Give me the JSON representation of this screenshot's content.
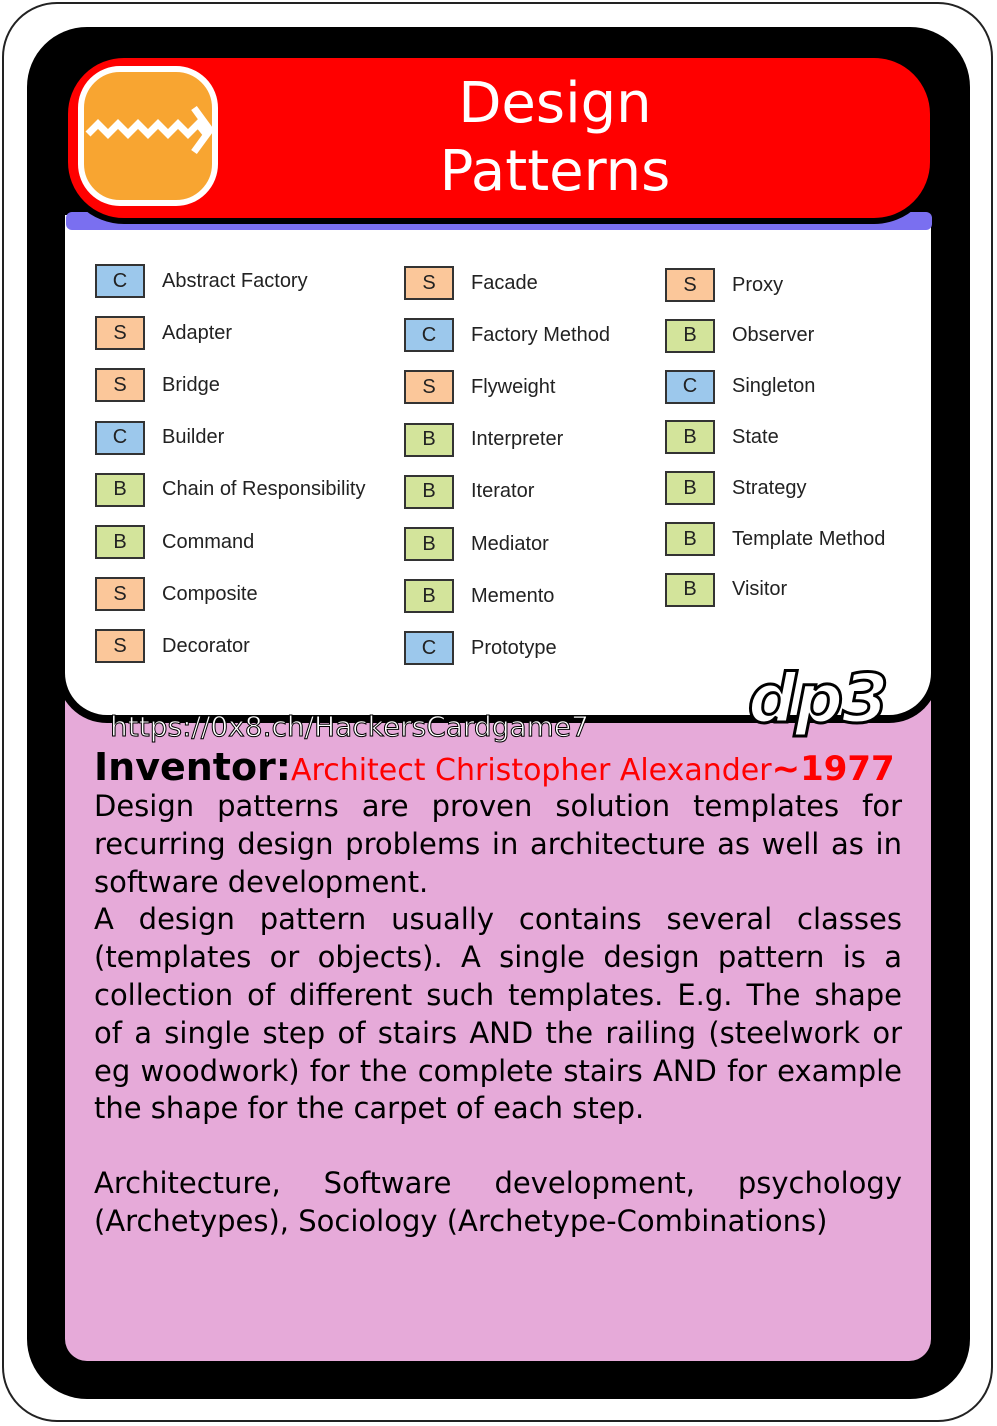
{
  "card": {
    "title_line1": "Design",
    "title_line2": "Patterns",
    "code": "dp3",
    "url": "https://0x8.ch/HackersCardgame7",
    "colors": {
      "header": "#ff0000",
      "body": "#e6aad9",
      "logo": "#f8a531"
    },
    "logo_icon": "zigzag-arrow-icon"
  },
  "patterns": [
    {
      "type": "C",
      "name": "Abstract Factory"
    },
    {
      "type": "S",
      "name": "Adapter"
    },
    {
      "type": "S",
      "name": "Bridge"
    },
    {
      "type": "C",
      "name": "Builder"
    },
    {
      "type": "B",
      "name": "Chain of Responsibility"
    },
    {
      "type": "B",
      "name": "Command"
    },
    {
      "type": "S",
      "name": "Composite"
    },
    {
      "type": "S",
      "name": "Decorator"
    },
    {
      "type": "S",
      "name": "Facade"
    },
    {
      "type": "C",
      "name": "Factory Method"
    },
    {
      "type": "S",
      "name": "Flyweight"
    },
    {
      "type": "B",
      "name": "Interpreter"
    },
    {
      "type": "B",
      "name": "Iterator"
    },
    {
      "type": "B",
      "name": "Mediator"
    },
    {
      "type": "B",
      "name": "Memento"
    },
    {
      "type": "C",
      "name": "Prototype"
    },
    {
      "type": "S",
      "name": "Proxy"
    },
    {
      "type": "B",
      "name": "Observer"
    },
    {
      "type": "C",
      "name": "Singleton"
    },
    {
      "type": "B",
      "name": "State"
    },
    {
      "type": "B",
      "name": "Strategy"
    },
    {
      "type": "B",
      "name": "Template Method"
    },
    {
      "type": "B",
      "name": "Visitor"
    }
  ],
  "inventor": {
    "label": "Inventor:",
    "name": "Architect Christopher Alexander",
    "year": "~1977"
  },
  "description": [
    "Design patterns are proven solution templates for recurring design problems in architecture as well as in software development.",
    "A design pattern usually contains several classes (templates or objects). A single design pattern is a collection of different such templates. E.g. The shape of a single step of stairs AND the railing (steelwork or eg woodwork) for the complete stairs AND for example the shape for the carpet of each step."
  ],
  "fields": "Architecture, Software development, psychology (Archetypes), Sociology (Archetype-Combinations)"
}
